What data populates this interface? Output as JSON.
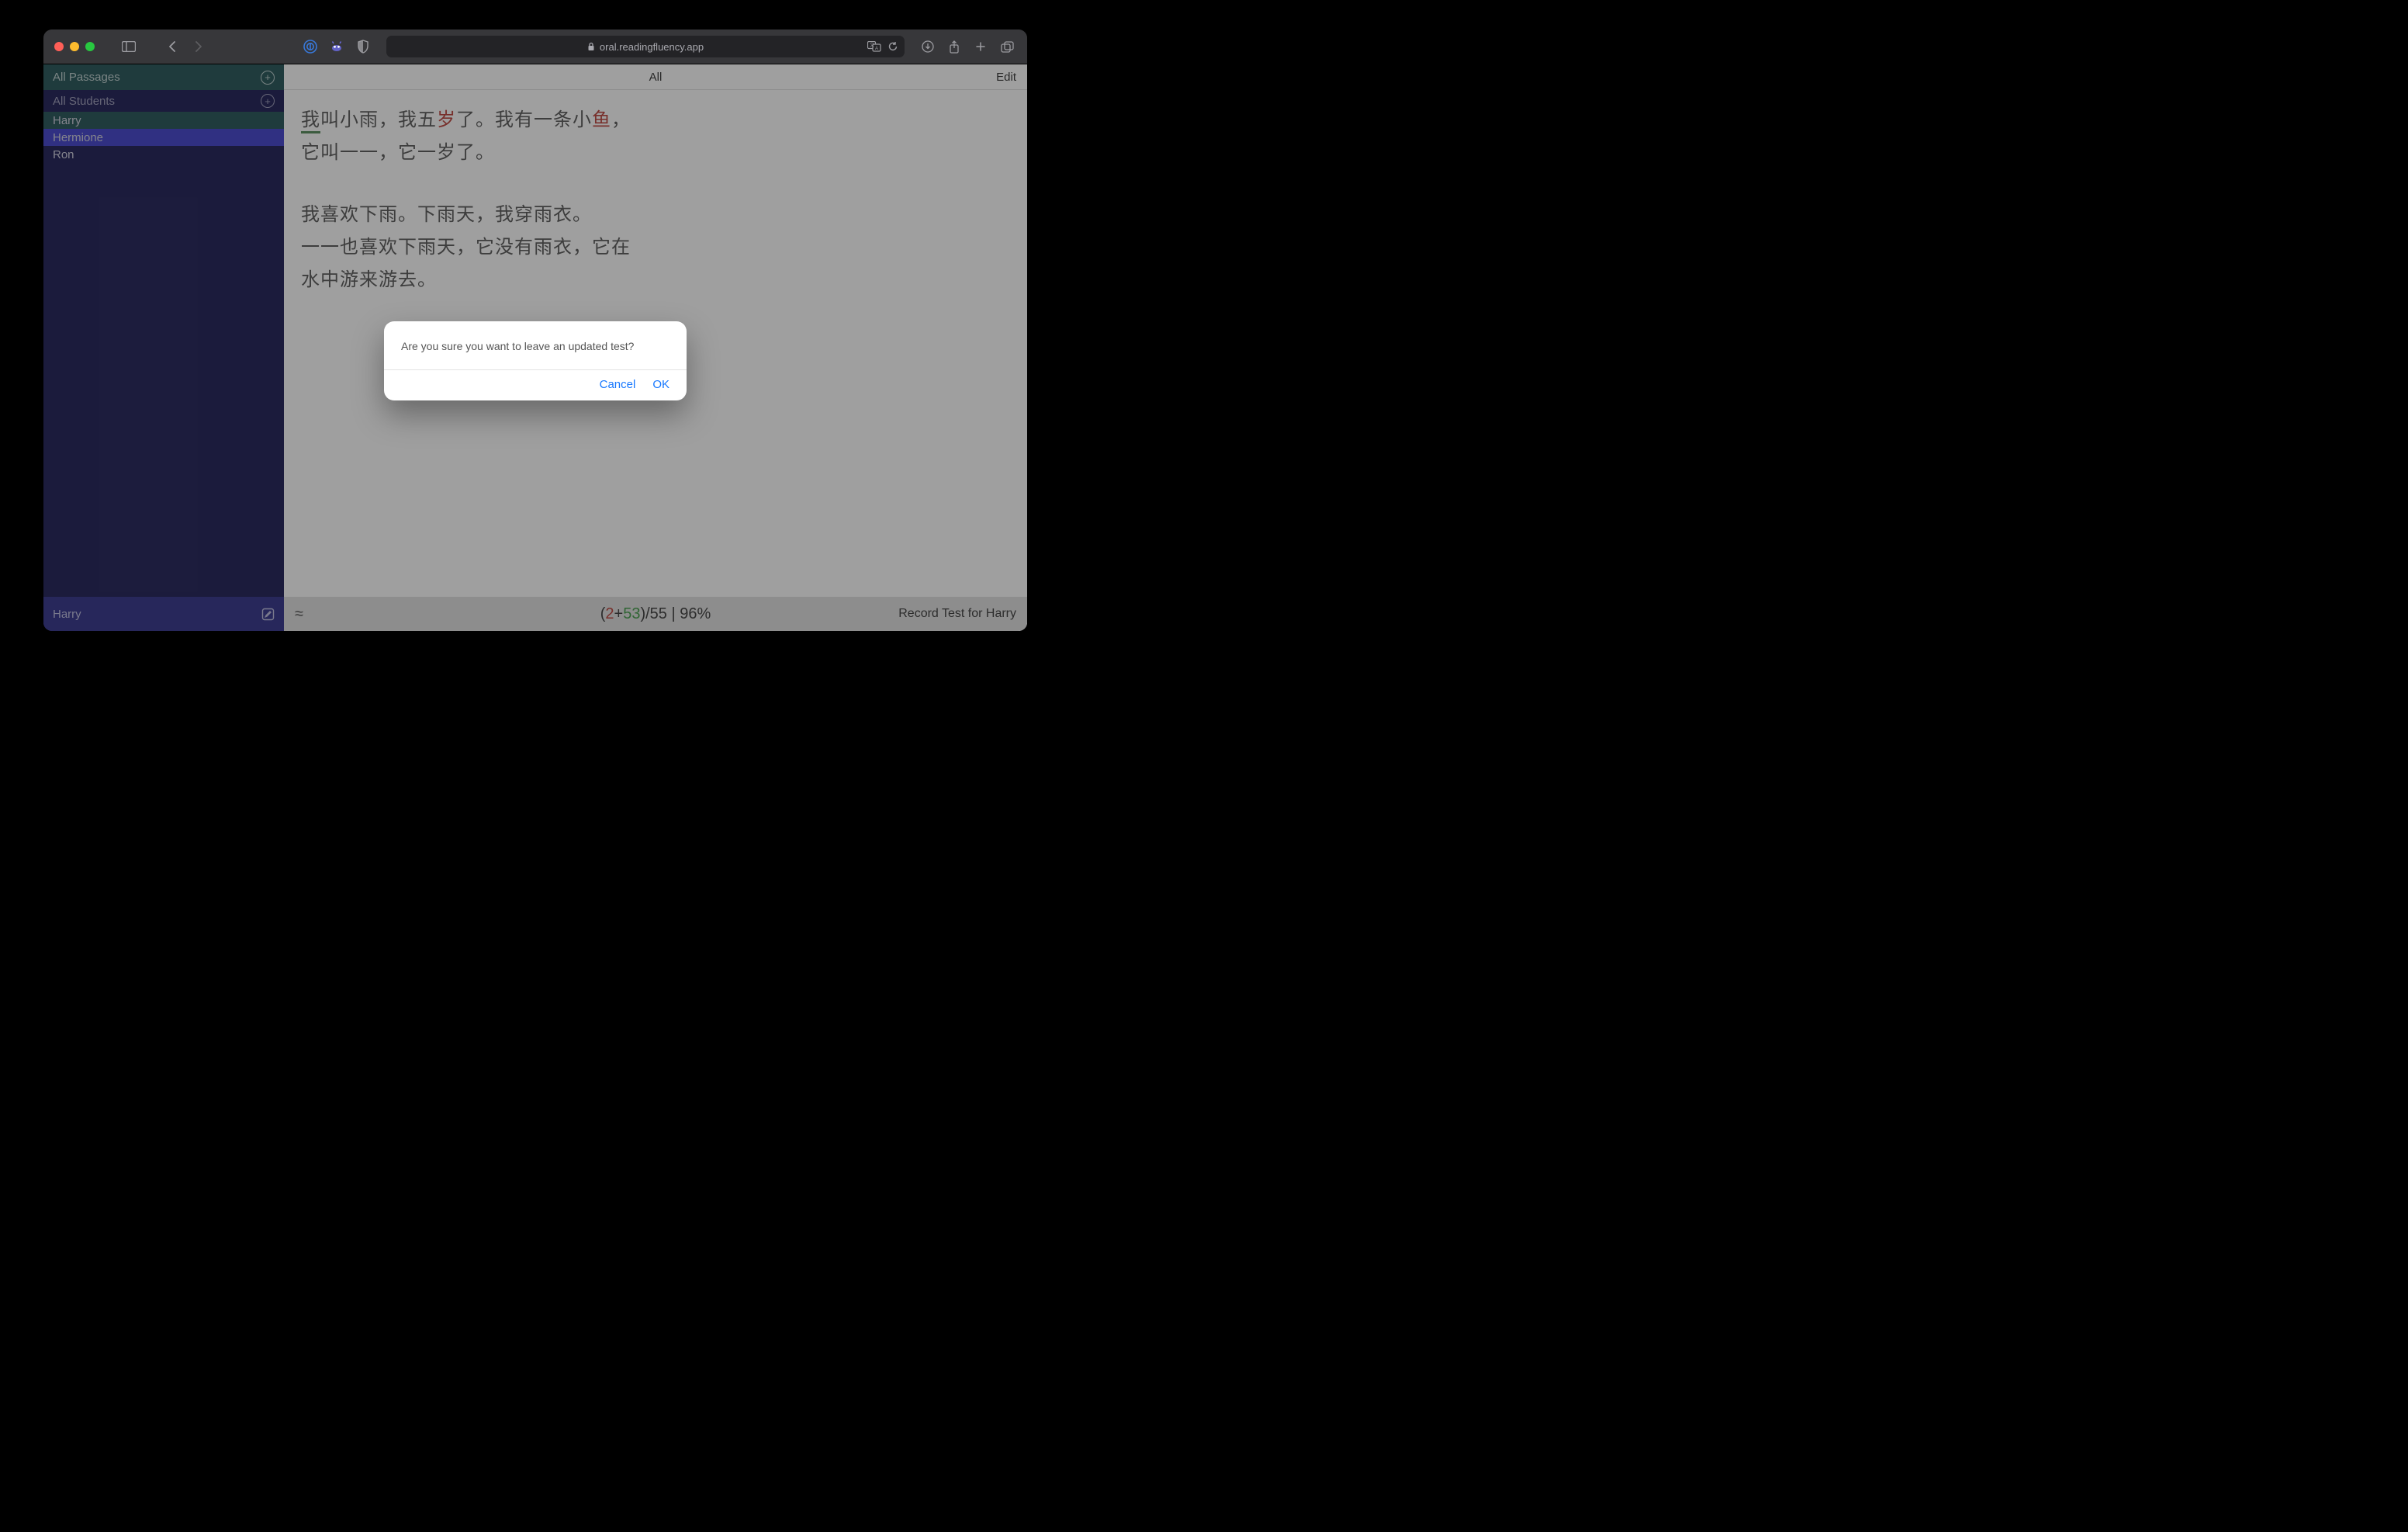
{
  "browser": {
    "url": "oral.readingfluency.app"
  },
  "sidebar": {
    "passages_label": "All Passages",
    "students_label": "All Students",
    "students": [
      "Harry",
      "Hermione",
      "Ron"
    ],
    "footer_name": "Harry"
  },
  "main": {
    "tab_label": "All",
    "edit_label": "Edit",
    "record_label": "Record Test for Harry"
  },
  "passage": {
    "l1a": "我叫小雨，我五",
    "l1_err": "岁",
    "l1b": "了。我有一条小",
    "l1_err2": "鱼",
    "l1c": "，",
    "l1_und": "我",
    "l2": "它叫一一，它一岁了。",
    "l3": "我喜欢下雨。下雨天，我穿雨衣。",
    "l4": "一一也喜欢下雨天，它没有雨衣，它在",
    "l5": "水中游来游去。"
  },
  "score": {
    "open": "(",
    "errors": "2",
    "plus": "+",
    "correct": "53",
    "close_total": ")/55",
    "sep": " | ",
    "pct": "96%"
  },
  "dialog": {
    "message": "Are you sure you want to leave an updated test?",
    "cancel": "Cancel",
    "ok": "OK"
  }
}
